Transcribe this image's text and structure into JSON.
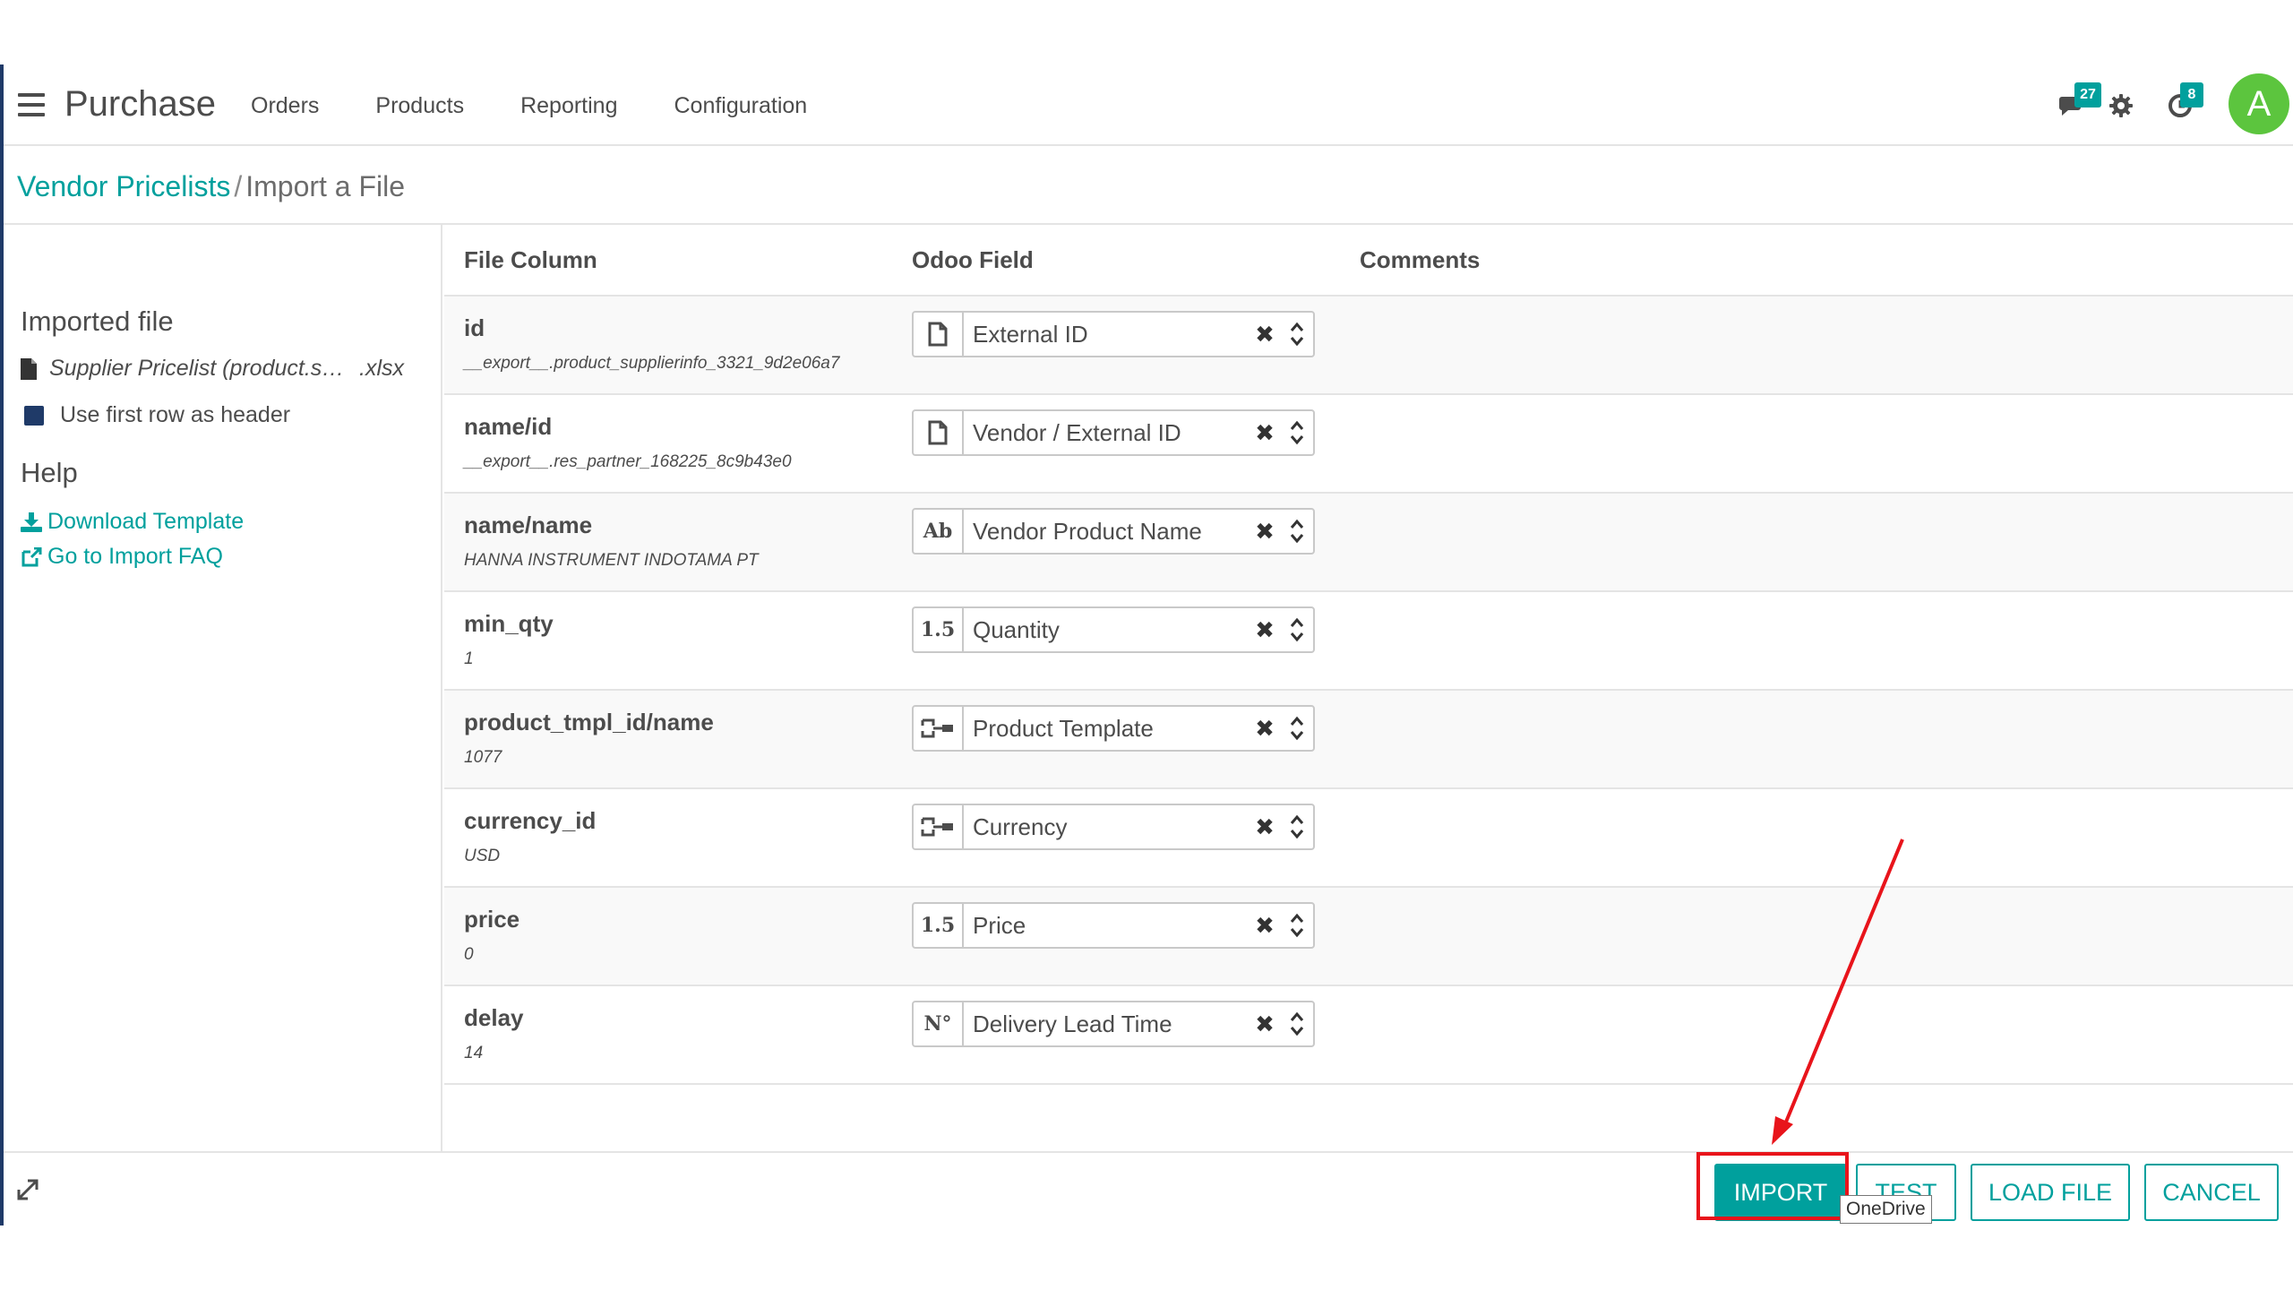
{
  "navbar": {
    "app_name": "Purchase",
    "menu": [
      "Orders",
      "Products",
      "Reporting",
      "Configuration"
    ],
    "messages_count": "27",
    "activities_count": "8",
    "avatar_letter": "A"
  },
  "breadcrumb": {
    "parent": "Vendor Pricelists",
    "separator": "/",
    "current": "Import a File"
  },
  "sidebar": {
    "imported_heading": "Imported file",
    "file_name": "Supplier Pricelist (product.supplierinfo)",
    "file_ext": ".xlsx",
    "header_checkbox_label": "Use first row as header",
    "header_checkbox_checked": true,
    "help_heading": "Help",
    "download_template": "Download Template",
    "import_faq": "Go to Import FAQ"
  },
  "table": {
    "headers": [
      "File Column",
      "Odoo Field",
      "Comments"
    ],
    "rows": [
      {
        "column": "id",
        "sample": "__export__.product_supplierinfo_3321_9d2e06a7",
        "type_icon": "file-icon",
        "field": "External ID"
      },
      {
        "column": "name/id",
        "sample": "__export__.res_partner_168225_8c9b43e0",
        "type_icon": "file-icon",
        "field": "Vendor / External ID"
      },
      {
        "column": "name/name",
        "sample": "HANNA INSTRUMENT INDOTAMA PT",
        "type_icon": "Ab",
        "field": "Vendor Product Name"
      },
      {
        "column": "min_qty",
        "sample": "1",
        "type_icon": "1.5",
        "field": "Quantity"
      },
      {
        "column": "product_tmpl_id/name",
        "sample": "1077",
        "type_icon": "relation-icon",
        "field": "Product Template"
      },
      {
        "column": "currency_id",
        "sample": "USD",
        "type_icon": "relation-icon",
        "field": "Currency"
      },
      {
        "column": "price",
        "sample": "0",
        "type_icon": "1.5",
        "field": "Price"
      },
      {
        "column": "delay",
        "sample": "14",
        "type_icon": "N°",
        "field": "Delivery Lead Time"
      }
    ]
  },
  "buttons": {
    "import": "IMPORT",
    "test": "TEST",
    "load_file": "LOAD FILE",
    "cancel": "CANCEL"
  },
  "tooltip": "OneDrive",
  "colors": {
    "accent": "#00a09d",
    "annotation": "#e8141b",
    "avatar": "#5cc53e",
    "checkbox": "#1f3a68"
  }
}
